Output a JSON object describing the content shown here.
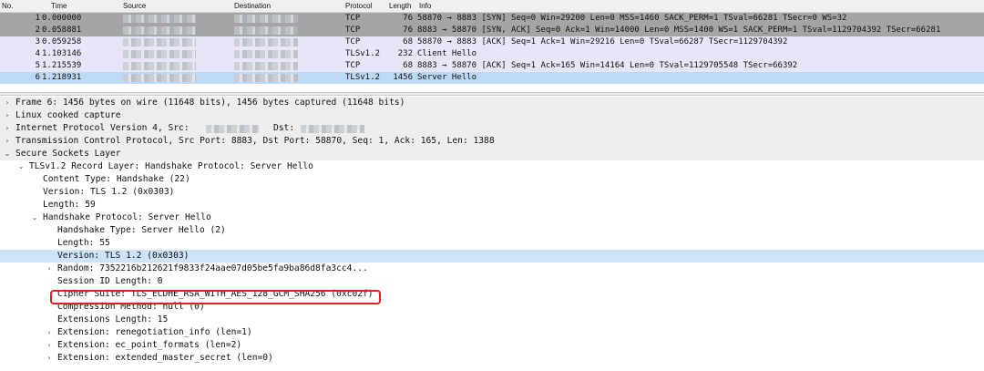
{
  "packet_list": {
    "columns": [
      "No.",
      "Time",
      "Source",
      "Destination",
      "Protocol",
      "Length",
      "Info"
    ],
    "rows": [
      {
        "no": "1",
        "time": "0.000000",
        "protocol": "TCP",
        "length": "76",
        "info": "58870 → 8883 [SYN] Seq=0 Win=29200 Len=0 MSS=1460 SACK_PERM=1 TSval=66281 TSecr=0 WS=32",
        "style": "gray"
      },
      {
        "no": "2",
        "time": "0.058881",
        "protocol": "TCP",
        "length": "76",
        "info": "8883 → 58870 [SYN, ACK] Seq=0 Ack=1 Win=14000 Len=0 MSS=1400 WS=1 SACK_PERM=1 TSval=1129704392 TSecr=66281",
        "style": "gray"
      },
      {
        "no": "3",
        "time": "0.059258",
        "protocol": "TCP",
        "length": "68",
        "info": "58870 → 8883 [ACK] Seq=1 Ack=1 Win=29216 Len=0 TSval=66287 TSecr=1129704392",
        "style": "lav"
      },
      {
        "no": "4",
        "time": "1.103146",
        "protocol": "TLSv1.2",
        "length": "232",
        "info": "Client Hello",
        "style": "lav"
      },
      {
        "no": "5",
        "time": "1.215539",
        "protocol": "TCP",
        "length": "68",
        "info": "8883 → 58870 [ACK] Seq=1 Ack=165 Win=14164 Len=0 TSval=1129705548 TSecr=66392",
        "style": "lav"
      },
      {
        "no": "6",
        "time": "1.218931",
        "protocol": "TLSv1.2",
        "length": "1456",
        "info": "Server Hello",
        "style": "sel"
      }
    ]
  },
  "details": {
    "lines": [
      {
        "text": "Frame 6: 1456 bytes on wire (11648 bits), 1456 bytes captured (11648 bits)",
        "indent": 0,
        "toggle": "›"
      },
      {
        "text": "Linux cooked capture",
        "indent": 0,
        "toggle": "›"
      },
      {
        "text": "Internet Protocol Version 4, Src:",
        "indent": 0,
        "toggle": "›",
        "blurred": true,
        "dst_label": "Dst:"
      },
      {
        "text": "Transmission Control Protocol, Src Port: 8883, Dst Port: 58870, Seq: 1, Ack: 165, Len: 1388",
        "indent": 0,
        "toggle": "›"
      },
      {
        "text": "Secure Sockets Layer",
        "indent": 0,
        "toggle": "⌄"
      },
      {
        "text": "TLSv1.2 Record Layer: Handshake Protocol: Server Hello",
        "indent": 1,
        "toggle": "⌄"
      },
      {
        "text": "Content Type: Handshake (22)",
        "indent": 2,
        "toggle": ""
      },
      {
        "text": "Version: TLS 1.2 (0x0303)",
        "indent": 2,
        "toggle": ""
      },
      {
        "text": "Length: 59",
        "indent": 2,
        "toggle": ""
      },
      {
        "text": "Handshake Protocol: Server Hello",
        "indent": 2,
        "toggle": "⌄"
      },
      {
        "text": "Handshake Type: Server Hello (2)",
        "indent": 3,
        "toggle": ""
      },
      {
        "text": "Length: 55",
        "indent": 3,
        "toggle": ""
      },
      {
        "text": "Version: TLS 1.2 (0x0303)",
        "indent": 3,
        "toggle": "",
        "highlight": true
      },
      {
        "text": "Random: 7352216b212621f9833f24aae07d05be5fa9ba86d8fa3cc4...",
        "indent": 3,
        "toggle": "›"
      },
      {
        "text": "Session ID Length: 0",
        "indent": 3,
        "toggle": ""
      },
      {
        "text": "Cipher Suite: TLS_ECDHE_RSA_WITH_AES_128_GCM_SHA256 (0xc02f)",
        "indent": 3,
        "toggle": ""
      },
      {
        "text": "Compression Method: null (0)",
        "indent": 3,
        "toggle": ""
      },
      {
        "text": "Extensions Length: 15",
        "indent": 3,
        "toggle": ""
      },
      {
        "text": "Extension: renegotiation_info (len=1)",
        "indent": 3,
        "toggle": "›"
      },
      {
        "text": "Extension: ec_point_formats (len=2)",
        "indent": 3,
        "toggle": "›"
      },
      {
        "text": "Extension: extended_master_secret (len=0)",
        "indent": 3,
        "toggle": "›"
      }
    ]
  },
  "colors": {
    "selected_row": "#bdd9f6",
    "tcp_handshake_row": "#a5a5a5",
    "tcp_row": "#e8e5f8",
    "annotation_box": "#e02020"
  }
}
